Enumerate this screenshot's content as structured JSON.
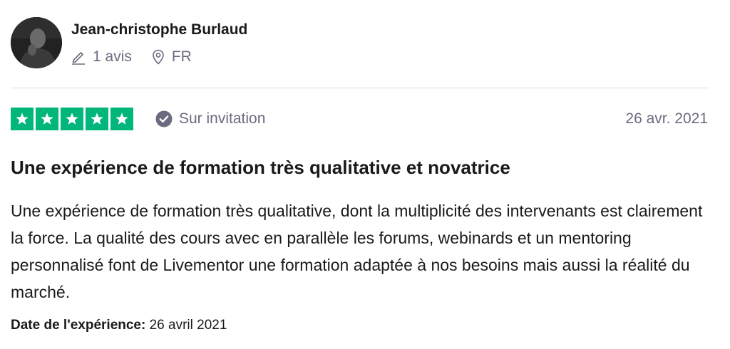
{
  "reviewer": {
    "name": "Jean-christophe Burlaud",
    "review_count": "1 avis",
    "country": "FR"
  },
  "rating": {
    "stars": 5,
    "max_stars": 5,
    "color": "#00b67a"
  },
  "verification": {
    "label": "Sur invitation"
  },
  "review": {
    "date": "26 avr. 2021",
    "title": "Une expérience de formation très qualitative et novatrice",
    "body": "Une expérience de formation très qualitative, dont la multiplicité des intervenants est clairement la force. La qualité des cours avec en parallèle les forums, webinards et un mentoring personnalisé font de Livementor une formation adaptée à nos besoins mais aussi la réalité du marché."
  },
  "experience": {
    "label": "Date de l'expérience:",
    "value": "26 avril 2021"
  },
  "icons": {
    "reviews": "pencil-icon",
    "location": "location-pin-icon",
    "verified": "check-circle-icon",
    "star": "star-icon"
  },
  "colors": {
    "muted_text": "#6b6b80",
    "divider": "#dcdce6",
    "verified_badge": "#6b6b80"
  }
}
